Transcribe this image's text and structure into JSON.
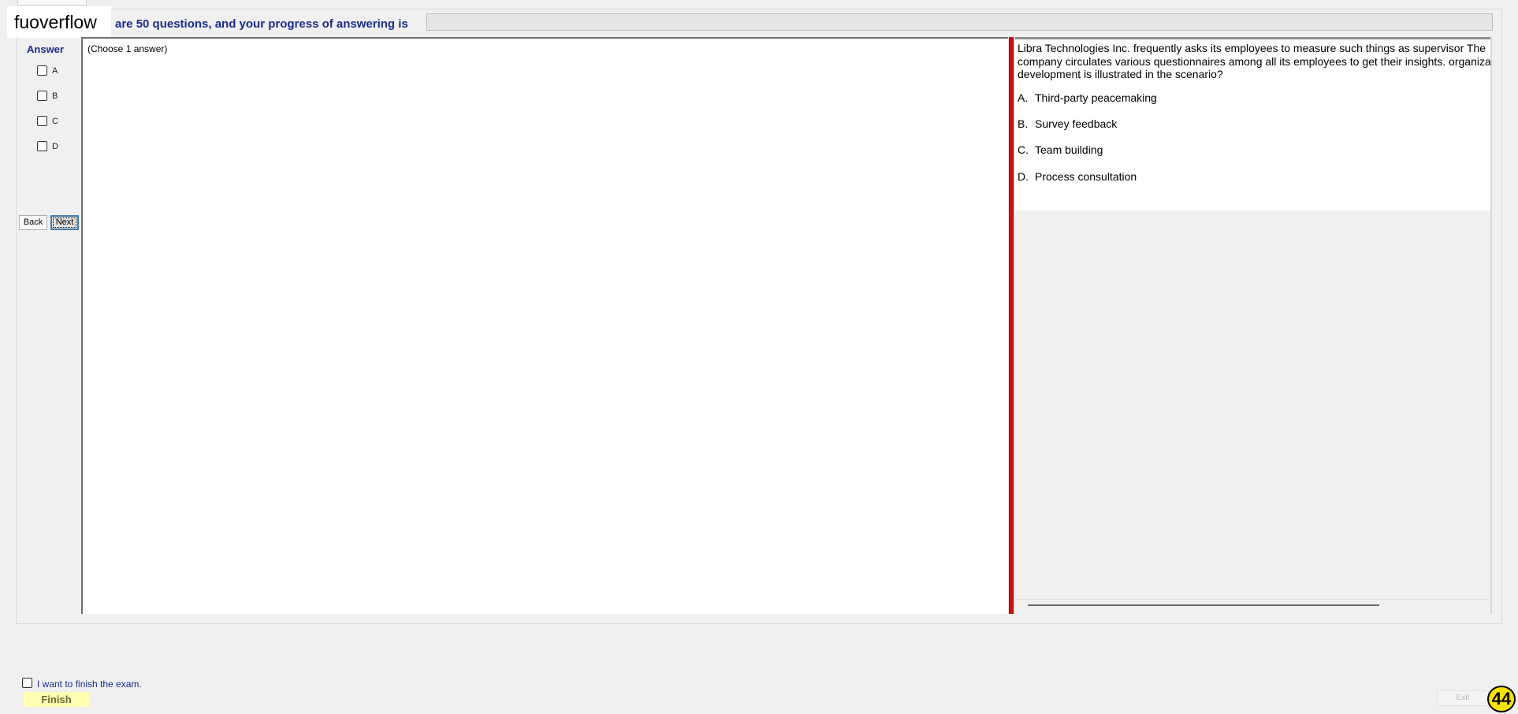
{
  "brand": {
    "text": "fuoverflow"
  },
  "header": {
    "progress_text": "are 50 questions, and your progress of answering is",
    "progress_fraction": 0
  },
  "answer_panel": {
    "label": "Answer",
    "options": [
      "A",
      "B",
      "C",
      "D"
    ],
    "back_label": "Back",
    "next_label": "Next"
  },
  "left_panel": {
    "instruction": "(Choose 1 answer)"
  },
  "question": {
    "stem": "Libra Technologies Inc. frequently asks its employees to measure such things as supervisor The company circulates various questionnaires among all its employees to get their insights. organization development is illustrated in the scenario?",
    "choices": [
      {
        "key": "A.",
        "text": "Third-party peacemaking"
      },
      {
        "key": "B.",
        "text": "Survey feedback"
      },
      {
        "key": "C.",
        "text": "Team building"
      },
      {
        "key": "D.",
        "text": "Process consultation"
      }
    ]
  },
  "footer": {
    "finish_check_label": "I want to finish the exam.",
    "finish_label": "Finish",
    "exit_label": "Exit",
    "badge_number": "44"
  },
  "colors": {
    "accent_blue": "#1a2c8a",
    "splitter_red": "#d40f0f",
    "finish_yellow": "#ffffb3",
    "badge_yellow": "#f5e300"
  }
}
